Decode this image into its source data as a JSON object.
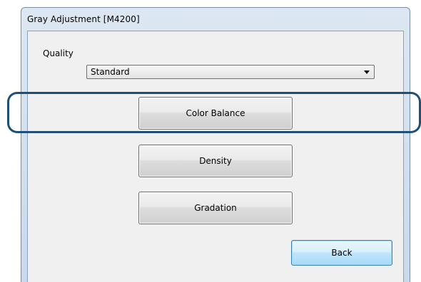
{
  "window": {
    "title": "Gray Adjustment [M4200]"
  },
  "quality": {
    "label": "Quality",
    "selected": "Standard"
  },
  "buttons": {
    "color_balance": "Color Balance",
    "density": "Density",
    "gradation": "Gradation",
    "back": "Back"
  },
  "colors": {
    "highlight": "#1f4e79",
    "default_button_border": "#3c7fb1"
  },
  "icons": {
    "dropdown": "chevron-down-icon"
  }
}
